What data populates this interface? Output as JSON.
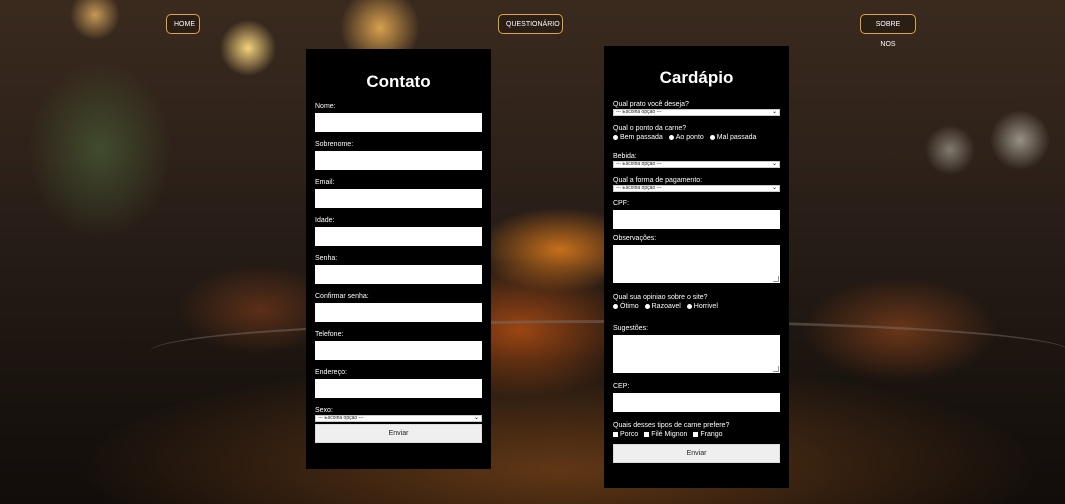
{
  "nav": {
    "home": "HOME",
    "questionario": "QUESTIONÁRIO",
    "sobre": "SOBRE NOS"
  },
  "contato": {
    "title": "Contato",
    "fields": {
      "nome": "Nome:",
      "sobrenome": "Sobrenome:",
      "email": "Email:",
      "idade": "Idade:",
      "senha": "Senha:",
      "confirmar": "Confirmar senha:",
      "telefone": "Telefone:",
      "endereco": "Endereço:"
    },
    "sexo_label": "Sexo:",
    "sexo_selected": "--- Escolha opção ---",
    "submit": "Enviar"
  },
  "cardapio": {
    "title": "Cardápio",
    "prato_label": "Qual prato você deseja?",
    "prato_selected": "--- Escolha opção ---",
    "ponto_label": "Qual o ponto da carne?",
    "ponto_options": [
      "Bem passada",
      "Ao ponto",
      "Mal passada"
    ],
    "bebida_label": "Bebida:",
    "bebida_selected": "--- Escolha opção ---",
    "pagamento_label": "Qual a forma de pagamento:",
    "pagamento_selected": "--- Escolha opção ---",
    "cpf_label": "CPF:",
    "obs_label": "Observações:",
    "opiniao_label": "Qual sua opiniao sobre o site?",
    "opiniao_options": [
      "Ótimo",
      "Razoavel",
      "Horrivel"
    ],
    "sugestoes_label": "Sugestões:",
    "cep_label": "CEP:",
    "carne_label": "Quais desses tipos de carne prefere?",
    "carne_options": [
      "Porco",
      "Filé Mignon",
      "Frango"
    ],
    "submit": "Enviar"
  },
  "colors": {
    "nav_border": "#e0a23a",
    "panel_bg": "#000000"
  }
}
